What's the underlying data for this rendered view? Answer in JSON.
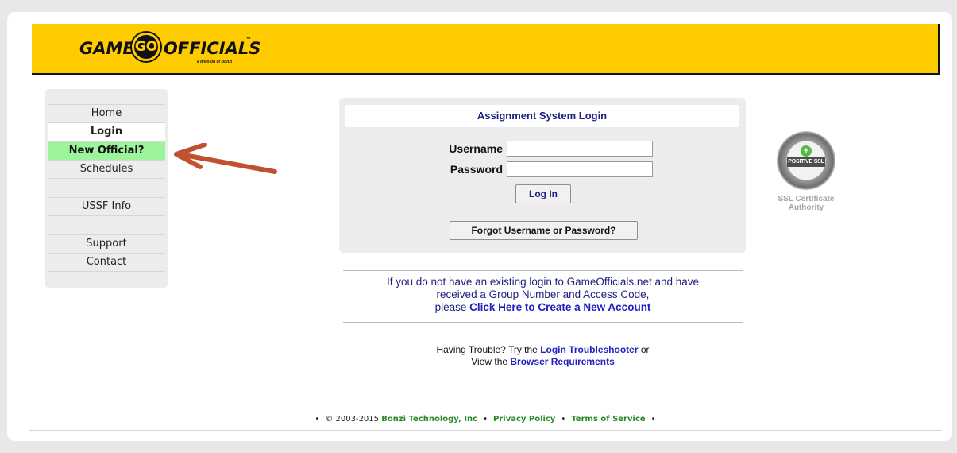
{
  "brand": {
    "logo_word_left": "GAME",
    "logo_circle": "GO",
    "logo_word_right": "OFFICIALS",
    "logo_trademark": "™",
    "logo_sub": "a division of Bonzi",
    "header_color": "#ffcc00"
  },
  "sidebar": {
    "items": [
      {
        "label": "Home",
        "state": "normal"
      },
      {
        "label": "Login",
        "state": "active"
      },
      {
        "label": "New Official?",
        "state": "highlight"
      },
      {
        "label": "Schedules",
        "state": "normal"
      },
      {
        "label": "USSF Info",
        "state": "normal"
      },
      {
        "label": "Support",
        "state": "normal"
      },
      {
        "label": "Contact",
        "state": "normal"
      }
    ],
    "highlight_color": "#9cf59c"
  },
  "login": {
    "title": "Assignment System Login",
    "username_label": "Username",
    "username_value": "",
    "password_label": "Password",
    "password_value": "",
    "login_button": "Log In",
    "forgot_button": "Forgot Username or Password?"
  },
  "ssl_badge": {
    "badge_text": "POSITIVE SSL",
    "caption_line1": "SSL Certificate",
    "caption_line2": "Authority"
  },
  "info": {
    "line1": "If you do not have an existing login to GameOfficials.net and have",
    "line2": "received a Group Number and Access Code,",
    "line3_prefix": "please ",
    "create_account_link": "Click Here to Create a New Account"
  },
  "trouble": {
    "prefix": "Having Trouble? Try the ",
    "troubleshooter_link": "Login Troubleshooter",
    "or": " or",
    "view_prefix": "View the ",
    "browser_link": "Browser Requirements"
  },
  "footer": {
    "bullet": "•",
    "copyright": "© 2003-2015 ",
    "company_link": "Bonzi Technology, Inc",
    "privacy_link": "Privacy Policy",
    "terms_link": "Terms of Service"
  },
  "annotation": {
    "arrow_color": "#c0502f"
  }
}
